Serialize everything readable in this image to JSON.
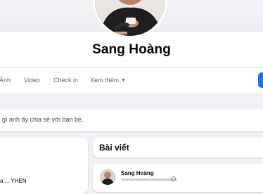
{
  "profile": {
    "name": "Sang Hoàng"
  },
  "tabs": [
    {
      "label": "Ảnh"
    },
    {
      "label": "Video"
    },
    {
      "label": "Check in"
    },
    {
      "label": "Xem thêm"
    }
  ],
  "status": {
    "placeholder": "gì anh ấy chia sẻ với bạn bè."
  },
  "intro": {
    "snippet": "a ... YHEN"
  },
  "posts": {
    "title": "Bài viết",
    "first_post_author": "Sang Hoàng"
  },
  "colors": {
    "accent": "#1b74e4",
    "page_bg": "#f0f2f5",
    "muted_text": "#65676b"
  },
  "icons": {
    "more_caret": "caret-down-icon",
    "privacy": "globe-icon"
  }
}
